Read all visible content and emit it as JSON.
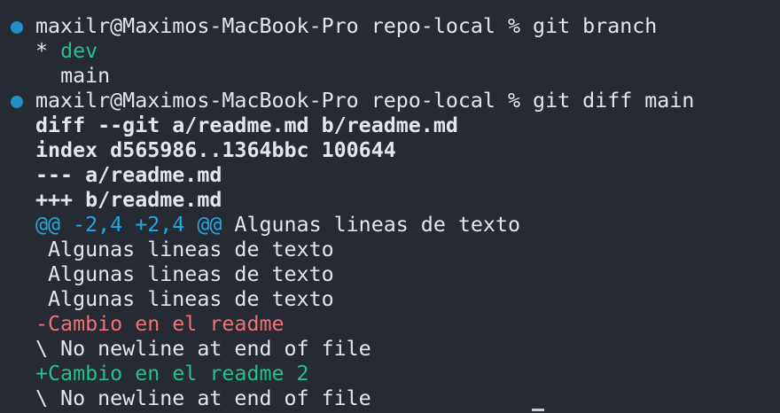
{
  "terminal": {
    "prompt1": {
      "prompt": "maxilr@Maximos-MacBook-Pro repo-local % ",
      "command": "git branch"
    },
    "branches": [
      {
        "marker": "* ",
        "name": "dev"
      },
      {
        "marker": "  ",
        "name": "main"
      }
    ],
    "prompt2": {
      "prompt": "maxilr@Maximos-MacBook-Pro repo-local % ",
      "command": "git diff main"
    },
    "diff_header": [
      "diff --git a/readme.md b/readme.md",
      "index d565986..1364bbc 100644",
      "--- a/readme.md",
      "+++ b/readme.md"
    ],
    "hunk": {
      "range": "@@ -2,4 +2,4 @@",
      "context": " Algunas lineas de texto"
    },
    "context_lines": [
      " Algunas lineas de texto",
      " Algunas lineas de texto",
      " Algunas lineas de texto"
    ],
    "removed_line": "-Cambio en el readme",
    "no_newline_1": "\\ No newline at end of file",
    "added_line": "+Cambio en el readme 2",
    "no_newline_2": "\\ No newline at end of file"
  },
  "colors": {
    "background": "#262a33",
    "text": "#e4e6ea",
    "green": "#27c08a",
    "red": "#f07178",
    "cyan": "#26a6e0",
    "prompt_mark": "#1f8fc6"
  }
}
